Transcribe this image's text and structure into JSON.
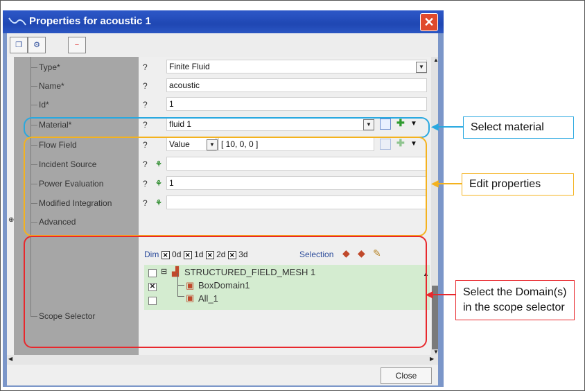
{
  "window": {
    "title": "Properties for acoustic 1",
    "close_glyph": "✕"
  },
  "toolbar": {
    "icons": [
      "window-icon",
      "add-settings-icon",
      "remove-icon"
    ]
  },
  "properties": [
    {
      "label": "Type*",
      "q": "?",
      "value": "Finite Fluid"
    },
    {
      "label": "Name*",
      "q": "?",
      "value": "acoustic"
    },
    {
      "label": "Id*",
      "q": "?",
      "value": "1"
    },
    {
      "label": "Material*",
      "q": "?",
      "value": "fluid 1"
    },
    {
      "label": "Flow Field",
      "q": "?",
      "mode": "Value",
      "value": "[ 10, 0, 0 ]"
    },
    {
      "label": "Incident Source",
      "q": "?",
      "value": ""
    },
    {
      "label": "Power Evaluation",
      "q": "?",
      "value": "1"
    },
    {
      "label": "Modified Integration",
      "q": "?",
      "value": ""
    },
    {
      "label": "Advanced"
    },
    {
      "label": "Scope Selector"
    }
  ],
  "scope": {
    "dim_label": "Dim",
    "dims": [
      "0d",
      "1d",
      "2d",
      "3d"
    ],
    "selection_label": "Selection",
    "tree": [
      {
        "label": "STRUCTURED_FIELD_MESH 1",
        "checked": false
      },
      {
        "label": "BoxDomain1",
        "checked": true
      },
      {
        "label": "All_1",
        "checked": false
      }
    ]
  },
  "footer": {
    "close_label": "Close"
  },
  "annotations": {
    "material": "Select material",
    "edit": "Edit properties",
    "scope": "Select the Domain(s) in the scope selector"
  },
  "colors": {
    "blue": "#29a8e0",
    "orange": "#f4b21e",
    "red": "#e8282d"
  }
}
